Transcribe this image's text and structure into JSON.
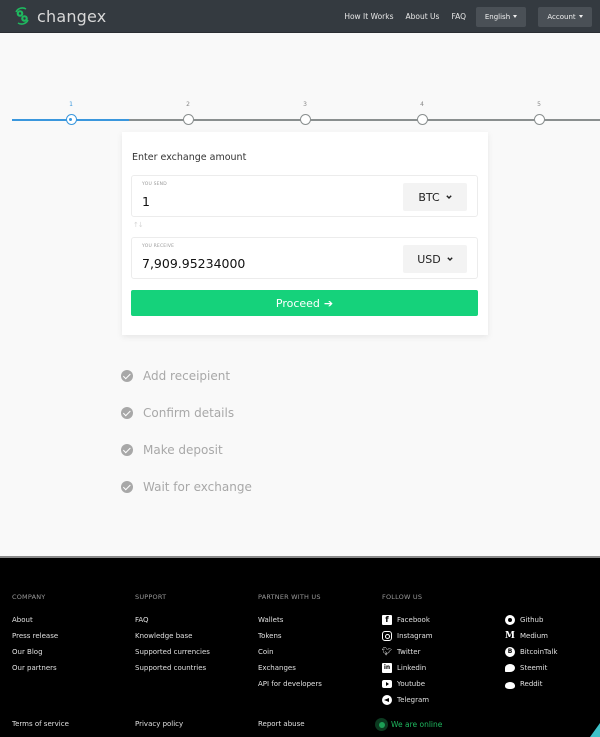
{
  "header": {
    "brand": "changex",
    "nav": [
      {
        "label": "How It Works"
      },
      {
        "label": "About Us"
      },
      {
        "label": "FAQ"
      }
    ],
    "language": "English",
    "account": "Account"
  },
  "stepper": {
    "steps": [
      "1",
      "2",
      "3",
      "4",
      "5"
    ],
    "current_step": 1,
    "colors": {
      "active": "#3a97dd",
      "inactive": "#8a8f8f"
    }
  },
  "exchange": {
    "title": "Enter exchange amount",
    "send": {
      "label": "YOU SEND",
      "value": "1",
      "currency": "BTC"
    },
    "swap_icon": "swap-arrows-icon",
    "receive": {
      "label": "YOU RECEIVE",
      "value": "7,909.95234000",
      "currency": "USD"
    },
    "proceed_label": "Proceed",
    "proceed_color": "#15d27b"
  },
  "next_steps": [
    {
      "label": "Add receipient",
      "icon": "check-circle-icon"
    },
    {
      "label": "Confirm details",
      "icon": "check-circle-icon"
    },
    {
      "label": "Make deposit",
      "icon": "check-circle-icon"
    },
    {
      "label": "Wait for exchange",
      "icon": "check-circle-icon"
    }
  ],
  "footer": {
    "company": {
      "heading": "COMPANY",
      "links": [
        "About",
        "Press release",
        "Our Blog",
        "Our partners"
      ]
    },
    "support": {
      "heading": "SUPPORT",
      "links": [
        "FAQ",
        "Knowledge base",
        "Supported currencies",
        "Supported countries"
      ]
    },
    "partner": {
      "heading": "PARTNER WITH US",
      "links": [
        "Wallets",
        "Tokens",
        "Coin",
        "Exchanges",
        "API for developers"
      ]
    },
    "follow": {
      "heading": "FOLLOW US",
      "col1": [
        {
          "label": "Facebook",
          "icon": "facebook-icon"
        },
        {
          "label": "Instagram",
          "icon": "instagram-icon"
        },
        {
          "label": "Twitter",
          "icon": "twitter-icon"
        },
        {
          "label": "Linkedin",
          "icon": "linkedin-icon"
        },
        {
          "label": "Youtube",
          "icon": "youtube-icon"
        },
        {
          "label": "Telegram",
          "icon": "telegram-icon"
        }
      ],
      "col2": [
        {
          "label": "Github",
          "icon": "github-icon"
        },
        {
          "label": "Medium",
          "icon": "medium-icon"
        },
        {
          "label": "BitcoinTalk",
          "icon": "bitcointalk-icon"
        },
        {
          "label": "Steemit",
          "icon": "steemit-icon"
        },
        {
          "label": "Reddit",
          "icon": "reddit-icon"
        }
      ]
    },
    "bottom": {
      "terms": "Terms of service",
      "privacy": "Privacy policy",
      "report": "Report abuse",
      "online": "We are online"
    }
  }
}
